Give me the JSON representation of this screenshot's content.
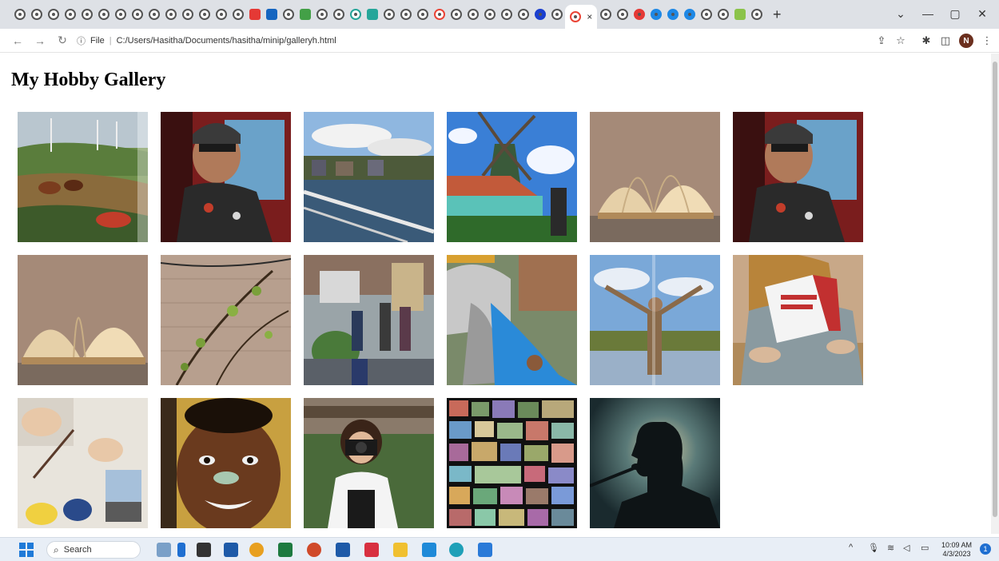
{
  "browser": {
    "address": {
      "scheme_label": "File",
      "path": "C:/Users/Hasitha/Documents/hasitha/minip/galleryh.html"
    },
    "profile_initial": "N",
    "active_tab_close": "×",
    "new_tab": "+"
  },
  "page": {
    "title": "My Hobby Gallery"
  },
  "gallery": {
    "images": [
      {
        "name": "landscape-horses-windmills"
      },
      {
        "name": "man-in-cap-car"
      },
      {
        "name": "canal-houses"
      },
      {
        "name": "dutch-windmill"
      },
      {
        "name": "open-book"
      },
      {
        "name": "man-in-cap-car-2"
      },
      {
        "name": "open-book-2"
      },
      {
        "name": "vine-on-wall"
      },
      {
        "name": "street-people"
      },
      {
        "name": "water-slide"
      },
      {
        "name": "person-arms-raised-lake"
      },
      {
        "name": "person-reading-book"
      },
      {
        "name": "painting-supplies"
      },
      {
        "name": "boy-portrait-painting"
      },
      {
        "name": "girl-with-camera"
      },
      {
        "name": "stamp-collection"
      },
      {
        "name": "singer-silhouette"
      }
    ]
  },
  "taskbar": {
    "search_label": "Search",
    "time": "10:09 AM",
    "date": "4/3/2023",
    "notification_count": "1"
  }
}
